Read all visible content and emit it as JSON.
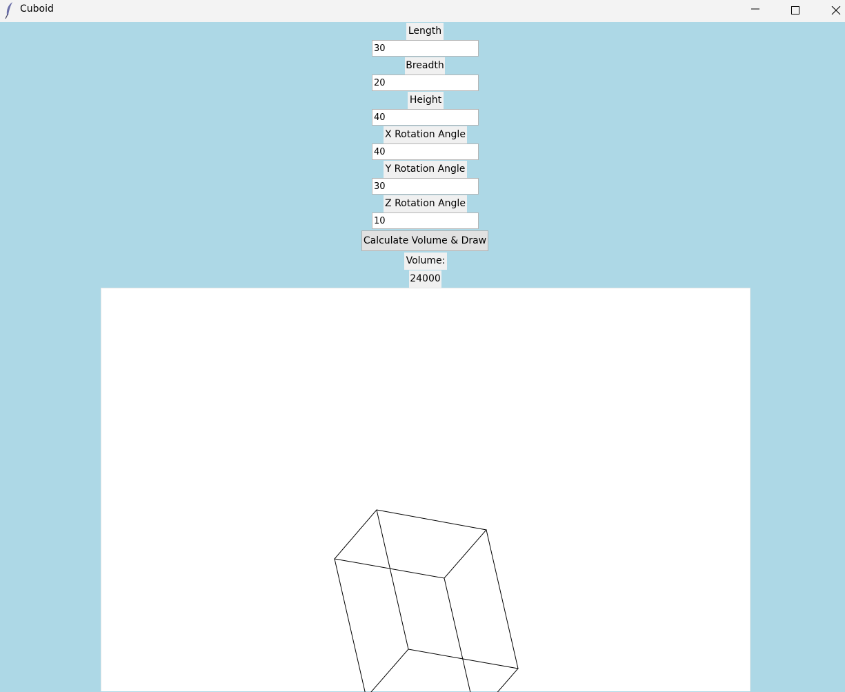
{
  "window": {
    "title": "Cuboid",
    "app_icon": "feather-icon",
    "controls": [
      "minimize-icon",
      "maximize-icon",
      "close-icon"
    ]
  },
  "form": {
    "length": {
      "label": "Length",
      "value": "30"
    },
    "breadth": {
      "label": "Breadth",
      "value": "20"
    },
    "height": {
      "label": "Height",
      "value": "40"
    },
    "x_rotation": {
      "label": "X Rotation Angle",
      "value": "40"
    },
    "y_rotation": {
      "label": "Y Rotation Angle",
      "value": "30"
    },
    "z_rotation": {
      "label": "Z Rotation Angle",
      "value": "10"
    },
    "calculate_button": "Calculate Volume & Draw",
    "volume_label": "Volume:",
    "volume_value": "24000"
  },
  "colors": {
    "background": "#add8e6",
    "label_background": "#f0f0f0",
    "canvas_background": "#ffffff",
    "wireframe": "#000000"
  }
}
